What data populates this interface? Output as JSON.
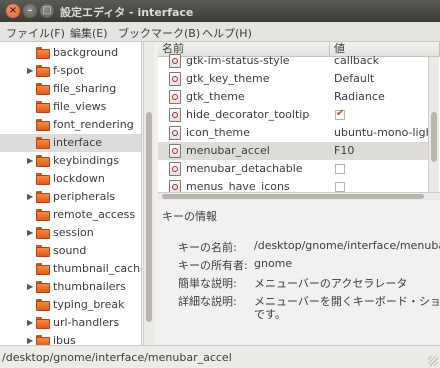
{
  "window": {
    "title": "設定エディタ - interface"
  },
  "menu": [
    "ファイル(F)",
    "編集(E)",
    "ブックマーク(B)",
    "ヘルプ(H)"
  ],
  "tree": {
    "items": [
      {
        "label": "background",
        "expander": false,
        "selected": false
      },
      {
        "label": "f-spot",
        "expander": true,
        "selected": false
      },
      {
        "label": "file_sharing",
        "expander": false,
        "selected": false
      },
      {
        "label": "file_views",
        "expander": false,
        "selected": false
      },
      {
        "label": "font_rendering",
        "expander": false,
        "selected": false
      },
      {
        "label": "interface",
        "expander": false,
        "selected": true
      },
      {
        "label": "keybindings",
        "expander": true,
        "selected": false
      },
      {
        "label": "lockdown",
        "expander": false,
        "selected": false
      },
      {
        "label": "peripherals",
        "expander": true,
        "selected": false
      },
      {
        "label": "remote_access",
        "expander": false,
        "selected": false
      },
      {
        "label": "session",
        "expander": true,
        "selected": false
      },
      {
        "label": "sound",
        "expander": false,
        "selected": false
      },
      {
        "label": "thumbnail_cache",
        "expander": false,
        "selected": false
      },
      {
        "label": "thumbnailers",
        "expander": true,
        "selected": false
      },
      {
        "label": "typing_break",
        "expander": false,
        "selected": false
      },
      {
        "label": "url-handlers",
        "expander": true,
        "selected": false
      },
      {
        "label": "ibus",
        "expander": true,
        "selected": false
      }
    ]
  },
  "table": {
    "col_name": "名前",
    "col_value": "値",
    "rows": [
      {
        "name": "gtk-im-status-style",
        "value": "callback",
        "type": "text",
        "selected": false
      },
      {
        "name": "gtk_key_theme",
        "value": "Default",
        "type": "text",
        "selected": false
      },
      {
        "name": "gtk_theme",
        "value": "Radiance",
        "type": "text",
        "selected": false
      },
      {
        "name": "hide_decorator_tooltip",
        "value": "",
        "type": "bool",
        "checked": true,
        "selected": false
      },
      {
        "name": "icon_theme",
        "value": "ubuntu-mono-ligh",
        "type": "text",
        "selected": false
      },
      {
        "name": "menubar_accel",
        "value": "F10",
        "type": "text",
        "selected": true
      },
      {
        "name": "menubar_detachable",
        "value": "",
        "type": "bool",
        "checked": false,
        "selected": false
      },
      {
        "name": "menus_have_icons",
        "value": "",
        "type": "bool",
        "checked": false,
        "selected": false
      }
    ]
  },
  "info": {
    "title": "キーの情報",
    "labels": {
      "name": "キーの名前:",
      "owner": "キーの所有者:",
      "short": "簡単な説明:",
      "long": "詳細な説明:"
    },
    "values": {
      "name": "/desktop/gnome/interface/menubar",
      "owner": "gnome",
      "short": "メニューバーのアクセラレータ",
      "long_line1": "メニューバーを開くキーボード・ショート",
      "long_line2": "です。"
    }
  },
  "status": {
    "text": "/desktop/gnome/interface/menubar_accel"
  },
  "colors": {
    "accent": "#e05a1b",
    "selection": "#dedcd8",
    "titlebar": "#3d3c37"
  }
}
